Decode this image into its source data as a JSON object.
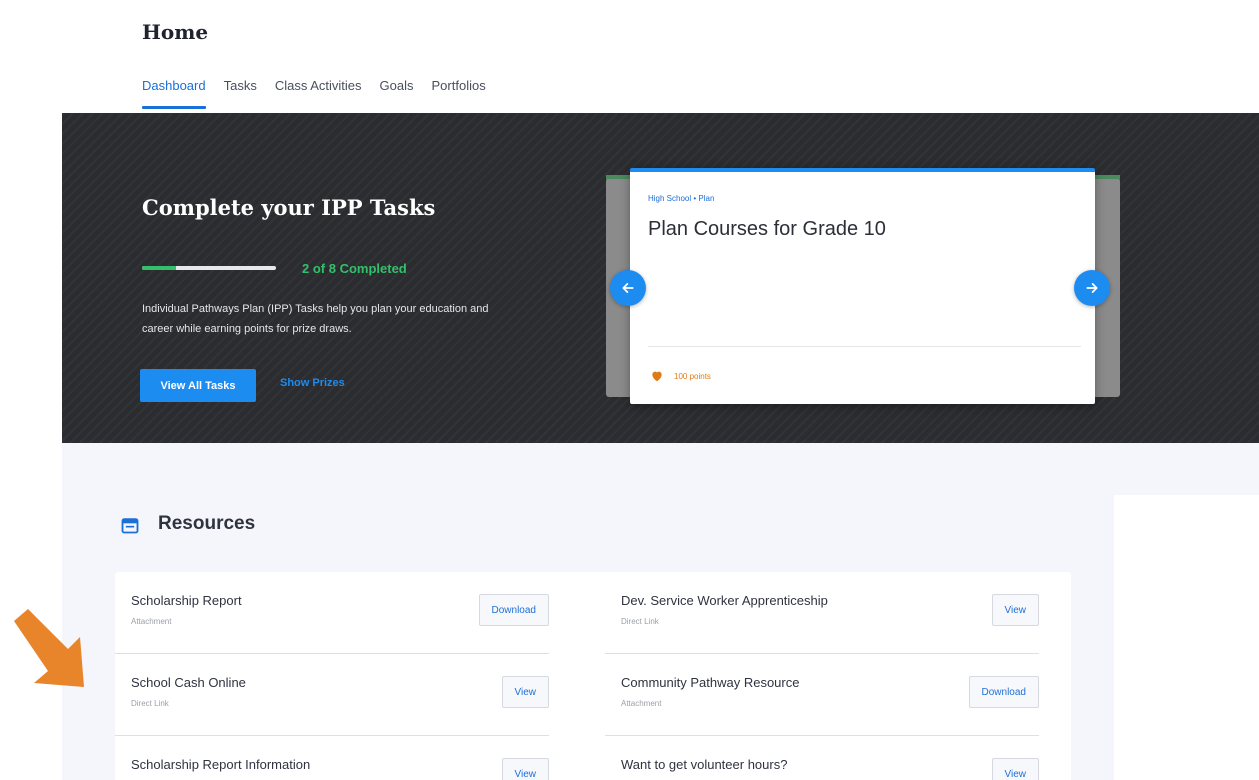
{
  "header": {
    "title": "Home",
    "tabs": [
      {
        "label": "Dashboard",
        "active": true
      },
      {
        "label": "Tasks",
        "active": false
      },
      {
        "label": "Class Activities",
        "active": false
      },
      {
        "label": "Goals",
        "active": false
      },
      {
        "label": "Portfolios",
        "active": false
      }
    ]
  },
  "hero": {
    "title": "Complete your IPP Tasks",
    "progress": {
      "completed": 2,
      "total": 8,
      "label": "2 of 8 Completed"
    },
    "description": "Individual Pathways Plan (IPP) Tasks help you plan your education and career while earning points for prize draws.",
    "primary_button": "View All Tasks",
    "secondary_link": "Show Prizes",
    "colors": {
      "accent": "#1d8cf0",
      "progress": "#34c06b",
      "points": "#e07a16"
    }
  },
  "carousel": {
    "card": {
      "breadcrumb": "High School • Plan",
      "title": "Plan Courses for Grade 10",
      "points": "100 points"
    },
    "prev_icon": "arrow-left-icon",
    "next_icon": "arrow-right-icon"
  },
  "resources": {
    "title": "Resources",
    "icon": "calendar-icon",
    "items": [
      {
        "name": "Scholarship Report",
        "type": "Attachment",
        "action": "Download"
      },
      {
        "name": "Dev. Service Worker Apprenticeship",
        "type": "Direct Link",
        "action": "View"
      },
      {
        "name": "School Cash Online",
        "type": "Direct Link",
        "action": "View"
      },
      {
        "name": "Community Pathway Resource",
        "type": "Attachment",
        "action": "Download"
      },
      {
        "name": "Scholarship Report Information",
        "type": "",
        "action": "View"
      },
      {
        "name": "Want to get volunteer hours?",
        "type": "",
        "action": "View"
      }
    ]
  }
}
